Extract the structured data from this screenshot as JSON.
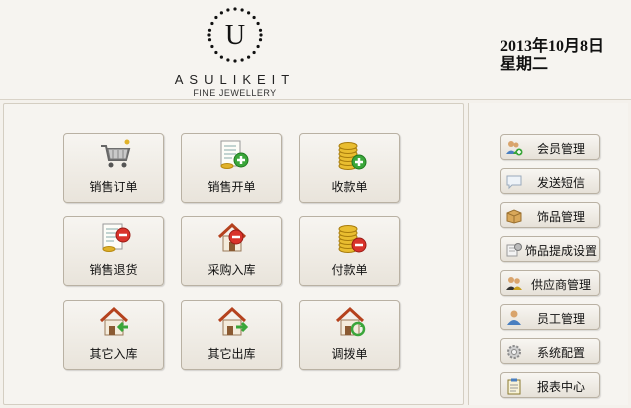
{
  "header": {
    "logo_letter": "U",
    "brand": "ASULIKEIT",
    "subtitle": "FINE JEWELLERY",
    "date": "2013年10月8日",
    "weekday": "星期二"
  },
  "tiles": [
    {
      "label": "销售订单",
      "icon": "shopping-cart-icon"
    },
    {
      "label": "销售开单",
      "icon": "document-add-icon"
    },
    {
      "label": "收款单",
      "icon": "coins-add-icon"
    },
    {
      "label": "销售退货",
      "icon": "document-remove-icon"
    },
    {
      "label": "采购入库",
      "icon": "house-remove-icon"
    },
    {
      "label": "付款单",
      "icon": "coins-remove-icon"
    },
    {
      "label": "其它入库",
      "icon": "house-in-icon"
    },
    {
      "label": "其它出库",
      "icon": "house-out-icon"
    },
    {
      "label": "调拨单",
      "icon": "house-transfer-icon"
    }
  ],
  "sidebar": [
    {
      "label": "会员管理",
      "icon": "users-add-icon"
    },
    {
      "label": "发送短信",
      "icon": "speech-bubble-icon"
    },
    {
      "label": "饰品管理",
      "icon": "box-icon"
    },
    {
      "label": "饰品提成设置",
      "icon": "settings-list-icon"
    },
    {
      "label": "供应商管理",
      "icon": "supplier-users-icon"
    },
    {
      "label": "员工管理",
      "icon": "person-icon"
    },
    {
      "label": "系统配置",
      "icon": "gear-icon"
    },
    {
      "label": "报表中心",
      "icon": "clipboard-icon"
    }
  ],
  "colors": {
    "background": "#f4f1ec",
    "button_border": "#b9b1a3",
    "accent_green": "#3aa63a",
    "accent_red": "#d9332b",
    "gold": "#e0b22a"
  }
}
